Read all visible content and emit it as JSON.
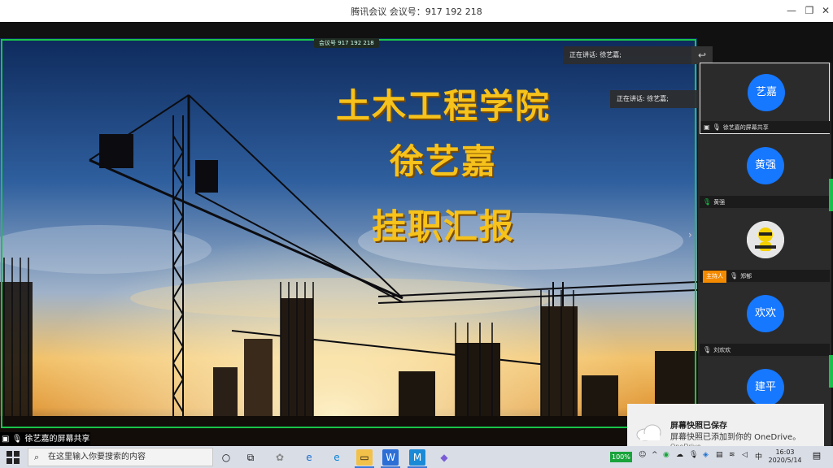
{
  "window": {
    "title": "腾讯会议 会议号：917 192 218",
    "controls": [
      "—",
      "❐",
      "✕"
    ]
  },
  "meeting_chip": "会议号 917 192 218",
  "slide": {
    "lines": [
      "土木工程学院",
      "徐艺嘉",
      "挂职汇报"
    ]
  },
  "speaking": {
    "primary": "正在讲话: 徐艺嘉;",
    "secondary": "正在讲话: 徐艺嘉;"
  },
  "participants": [
    {
      "avatar_text": "艺嘉",
      "name": "徐艺嘉的屏幕共享",
      "active": true
    },
    {
      "avatar_text": "黄强",
      "name": "黄强",
      "active": false
    },
    {
      "avatar_text": "",
      "name": "郑郁",
      "host_label": "主持人",
      "active": false
    },
    {
      "avatar_text": "欢欢",
      "name": "刘欢欢",
      "active": false
    },
    {
      "avatar_text": "建平",
      "name": "",
      "active": false
    }
  ],
  "share_caption": "徐艺嘉的屏幕共享",
  "toast": {
    "title": "屏幕快照已保存",
    "body": "屏幕快照已添加到你的 OneDrive。",
    "app": "OneDrive"
  },
  "taskbar": {
    "search_placeholder": "在这里输入你要搜索的内容",
    "battery": "100%",
    "ime": "中",
    "time": "16:03",
    "date": "2020/5/14"
  },
  "colors": {
    "accent_green": "#19c34b",
    "avatar_blue": "#1677ff",
    "title_gold": "#f6c21b",
    "host_orange": "#f48a00"
  }
}
